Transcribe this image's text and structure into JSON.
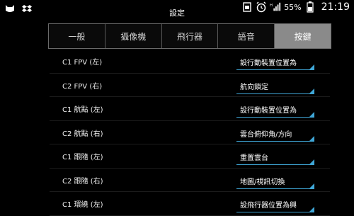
{
  "status": {
    "battery": "55%",
    "time": "21:19"
  },
  "title": "設定",
  "tabs": [
    {
      "label": "一般"
    },
    {
      "label": "攝像機"
    },
    {
      "label": "飛行器"
    },
    {
      "label": "語音"
    },
    {
      "label": "按鍵"
    }
  ],
  "active_tab": 4,
  "rows": [
    {
      "label": "C1 FPV (左)",
      "value": "設行動裝置位置為"
    },
    {
      "label": "C2 FPV (右)",
      "value": "航向鎖定"
    },
    {
      "label": "C1 航點 (左)",
      "value": "設行動裝置位置為"
    },
    {
      "label": "C2 航點 (右)",
      "value": "雲台俯仰角/方向"
    },
    {
      "label": "C1 跟隨 (左)",
      "value": "重置雲台"
    },
    {
      "label": "C2 跟隨 (右)",
      "value": "地圖/視訊切換"
    },
    {
      "label": "C1 環繞 (左)",
      "value": "設飛行器位置為興"
    }
  ],
  "colors": {
    "accent": "#3fa6d6",
    "active_tab": "#8a8a8a",
    "background": "#000000"
  },
  "icons": [
    "cat-icon",
    "dropbox-icon",
    "sim-icon",
    "alarm-icon",
    "signal-icon",
    "battery-icon"
  ]
}
